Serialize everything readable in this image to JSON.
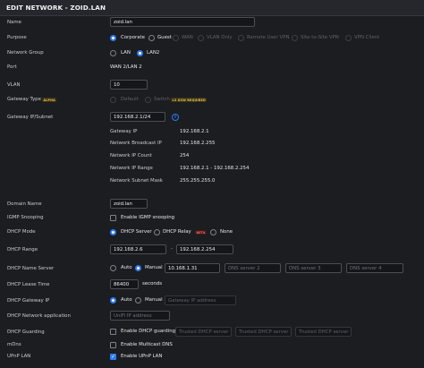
{
  "title": "EDIT NETWORK - ZOID.LAN",
  "name": {
    "label": "Name",
    "value": "zoid.lan"
  },
  "purpose": {
    "label": "Purpose",
    "options": [
      "Corporate",
      "Guest",
      "WAN",
      "VLAN Only",
      "Remote User VPN",
      "Site-to-Site VPN",
      "VPN Client"
    ],
    "selected": "Corporate"
  },
  "network_group": {
    "label": "Network Group",
    "options": [
      "LAN",
      "LAN2"
    ],
    "selected": "LAN2"
  },
  "port": {
    "label": "Port",
    "value": "WAN 2/LAN 2"
  },
  "vlan": {
    "label": "VLAN",
    "value": "10"
  },
  "gateway_type": {
    "label": "Gateway Type",
    "badge": "ALPHA",
    "options": [
      "Default",
      "Switch"
    ],
    "switch_badge": "L3 USW REQUIRED"
  },
  "gateway_subnet": {
    "label": "Gateway IP/Subnet",
    "value": "192.168.2.1/24",
    "details": [
      {
        "label": "Gateway IP",
        "value": "192.168.2.1"
      },
      {
        "label": "Network Broadcast IP",
        "value": "192.168.2.255"
      },
      {
        "label": "Network IP Count",
        "value": "254"
      },
      {
        "label": "Network IP Range",
        "value": "192.168.2.1 - 192.168.2.254"
      },
      {
        "label": "Network Subnet Mask",
        "value": "255.255.255.0"
      }
    ]
  },
  "domain_name": {
    "label": "Domain Name",
    "value": "zoid.lan"
  },
  "igmp": {
    "label": "IGMP Snooping",
    "option": "Enable IGMP snooping",
    "checked": false
  },
  "dhcp_mode": {
    "label": "DHCP Mode",
    "options": [
      "DHCP Server",
      "DHCP Relay",
      "None"
    ],
    "relay_badge": "BETA",
    "selected": "DHCP Server"
  },
  "dhcp_range": {
    "label": "DHCP Range",
    "start": "192.168.2.6",
    "end": "192.168.2.254",
    "separator": "-"
  },
  "dhcp_name_server": {
    "label": "DHCP Name Server",
    "options": [
      "Auto",
      "Manual"
    ],
    "selected": "Manual",
    "value": "10.168.1.31",
    "placeholders": [
      "DNS server 2",
      "DNS server 3",
      "DNS server 4"
    ]
  },
  "dhcp_lease": {
    "label": "DHCP Lease Time",
    "value": "86400",
    "unit": "seconds"
  },
  "dhcp_gateway": {
    "label": "DHCP Gateway IP",
    "options": [
      "Auto",
      "Manual"
    ],
    "selected": "Auto",
    "placeholder": "Gateway IP address"
  },
  "dhcp_network_app": {
    "label": "DHCP Network application",
    "placeholder": "UniFi IP address"
  },
  "dhcp_guarding": {
    "label": "DHCP Guarding",
    "option": "Enable DHCP guarding",
    "checked": false,
    "placeholders": [
      "Trusted DHCP server 1",
      "Trusted DHCP server 2",
      "Trusted DHCP server 3"
    ]
  },
  "mdns": {
    "label": "mDns",
    "option": "Enable Multicast DNS",
    "checked": false
  },
  "upnp": {
    "label": "UPnP LAN",
    "option": "Enable UPnP LAN",
    "checked": true,
    "check_glyph": "✓"
  },
  "colors": {
    "accent": "#2f7bf5",
    "background": "#1c1d21",
    "alpha_badge": "#e6c35a",
    "beta_badge": "#ff6b6b"
  }
}
